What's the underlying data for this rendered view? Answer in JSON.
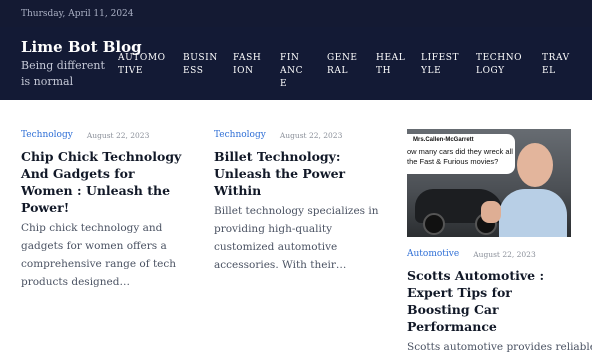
{
  "topbar": {
    "date": "Thursday, April 11, 2024"
  },
  "header": {
    "title": "Lime Bot Blog",
    "tagline": "Being different is normal"
  },
  "nav": [
    {
      "label": "AUTOMOTIVE"
    },
    {
      "label": "BUSINESS"
    },
    {
      "label": "FASHION"
    },
    {
      "label": "FINANCE"
    },
    {
      "label": "GENERAL"
    },
    {
      "label": "HEALTH"
    },
    {
      "label": "LIFESTYLE"
    },
    {
      "label": "TECHNOLOGY"
    },
    {
      "label": "TRAVEL"
    }
  ],
  "posts": [
    {
      "category": "Technology",
      "date": "August 22, 2023",
      "title": "Chip Chick Technology And Gadgets for Women : Unleash the Power!",
      "excerpt": "Chip chick technology and gadgets for women offers a comprehensive range of tech products designed…"
    },
    {
      "category": "Technology",
      "date": "August 22, 2023",
      "title": "Billet Technology: Unleash the Power Within",
      "excerpt": "Billet technology specializes in providing high-quality customized automotive accessories. With their…"
    },
    {
      "category": "Automotive",
      "date": "August 22, 2023",
      "title": "Scotts Automotive : Expert Tips for Boosting Car Performance",
      "excerpt": "Scotts automotive provides reliable",
      "image": {
        "caption_name": "Mrs.Callen-McGarrett",
        "caption_text": "ow many cars did they wreck all the Fast & Furious movies?"
      }
    }
  ]
}
